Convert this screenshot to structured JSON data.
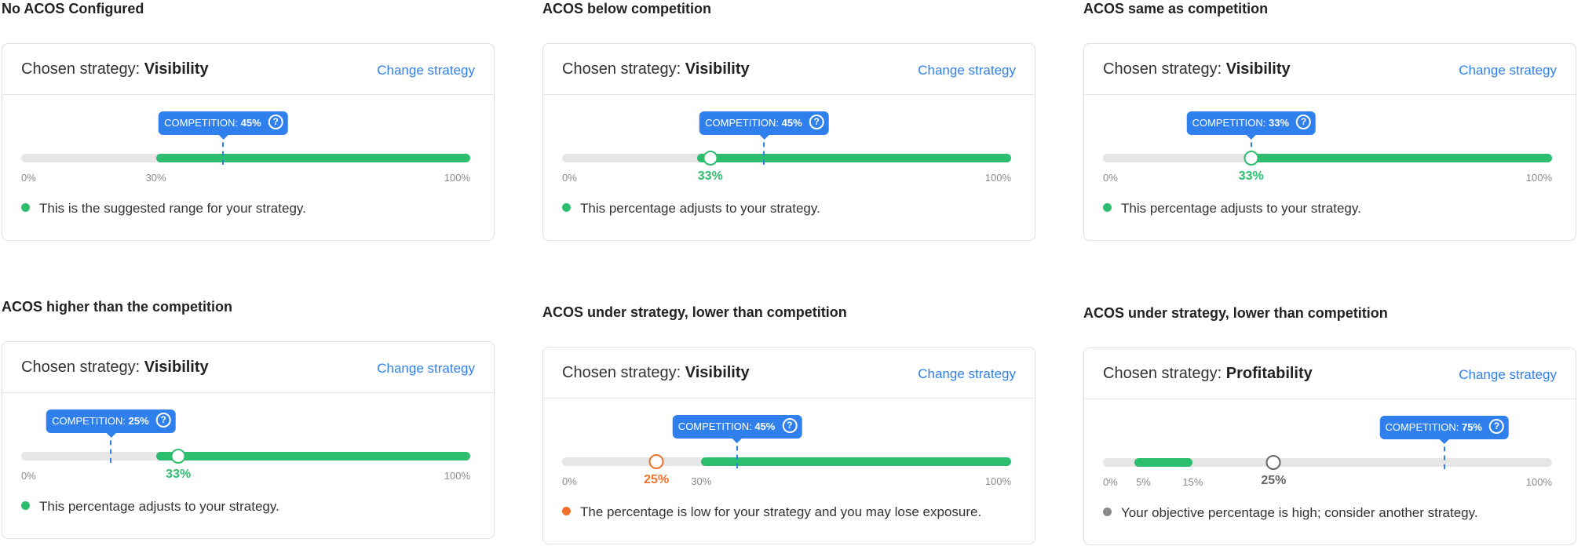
{
  "labels": {
    "chosen_prefix": "Chosen strategy:",
    "change_strategy": "Change strategy",
    "competition_prefix": "COMPETITION:",
    "help_glyph": "?"
  },
  "colors": {
    "green": "#2dbd6e",
    "blue": "#2f80ed",
    "orange": "#f2702a",
    "gray": "#888888",
    "track": "#e6e6e6"
  },
  "panels": [
    {
      "title": "No ACOS Configured",
      "strategy": "Visibility",
      "competition": "45%",
      "competition_value": 45,
      "range": [
        30,
        100
      ],
      "ticks": [
        {
          "label": "0%",
          "value": 0
        },
        {
          "label": "30%",
          "value": 30
        },
        {
          "label": "100%",
          "value": 100
        }
      ],
      "message": "This is the suggested range for your strategy.",
      "status": "green"
    },
    {
      "title": "ACOS below competition",
      "strategy": "Visibility",
      "competition": "45%",
      "competition_value": 45,
      "range": [
        30,
        100
      ],
      "knob_value": 33,
      "knob_label": "33%",
      "knob_color": "green",
      "ticks": [
        {
          "label": "0%",
          "value": 0
        },
        {
          "label": "100%",
          "value": 100
        }
      ],
      "message": "This percentage adjusts to your strategy.",
      "status": "green"
    },
    {
      "title": "ACOS same as competition",
      "strategy": "Visibility",
      "competition": "33%",
      "competition_value": 33,
      "range": [
        32,
        100
      ],
      "knob_value": 33,
      "knob_label": "33%",
      "knob_color": "green",
      "ticks": [
        {
          "label": "0%",
          "value": 0
        },
        {
          "label": "100%",
          "value": 100
        }
      ],
      "message": "This percentage adjusts to your strategy.",
      "status": "green"
    },
    {
      "title": "ACOS higher than the competition",
      "strategy": "Visibility",
      "competition": "25%",
      "competition_value": 20,
      "range": [
        30,
        100
      ],
      "knob_value": 35,
      "knob_label": "33%",
      "knob_color": "green",
      "ticks": [
        {
          "label": "0%",
          "value": 0
        },
        {
          "label": "100%",
          "value": 100
        }
      ],
      "message": "This percentage adjusts to your strategy.",
      "status": "green"
    },
    {
      "title": "ACOS under strategy, lower than competition",
      "strategy": "Visibility",
      "competition": "45%",
      "competition_value": 39,
      "range": [
        31,
        100
      ],
      "knob_value": 21,
      "knob_label": "25%",
      "knob_color": "orange",
      "ticks": [
        {
          "label": "0%",
          "value": 0
        },
        {
          "label": "30%",
          "value": 31
        },
        {
          "label": "100%",
          "value": 100
        }
      ],
      "message": "The percentage is low for your strategy and you may lose exposure.",
      "status": "orange"
    },
    {
      "title": "ACOS under strategy, lower than competition",
      "strategy": "Profitability",
      "competition": "75%",
      "competition_value": 76,
      "range": [
        7,
        20
      ],
      "knob_value": 38,
      "knob_label": "25%",
      "knob_color": "gray",
      "ticks": [
        {
          "label": "0%",
          "value": 0
        },
        {
          "label": "5%",
          "value": 9
        },
        {
          "label": "15%",
          "value": 20
        },
        {
          "label": "100%",
          "value": 100
        }
      ],
      "message": "Your objective percentage is high; consider another strategy.",
      "status": "gray"
    }
  ]
}
